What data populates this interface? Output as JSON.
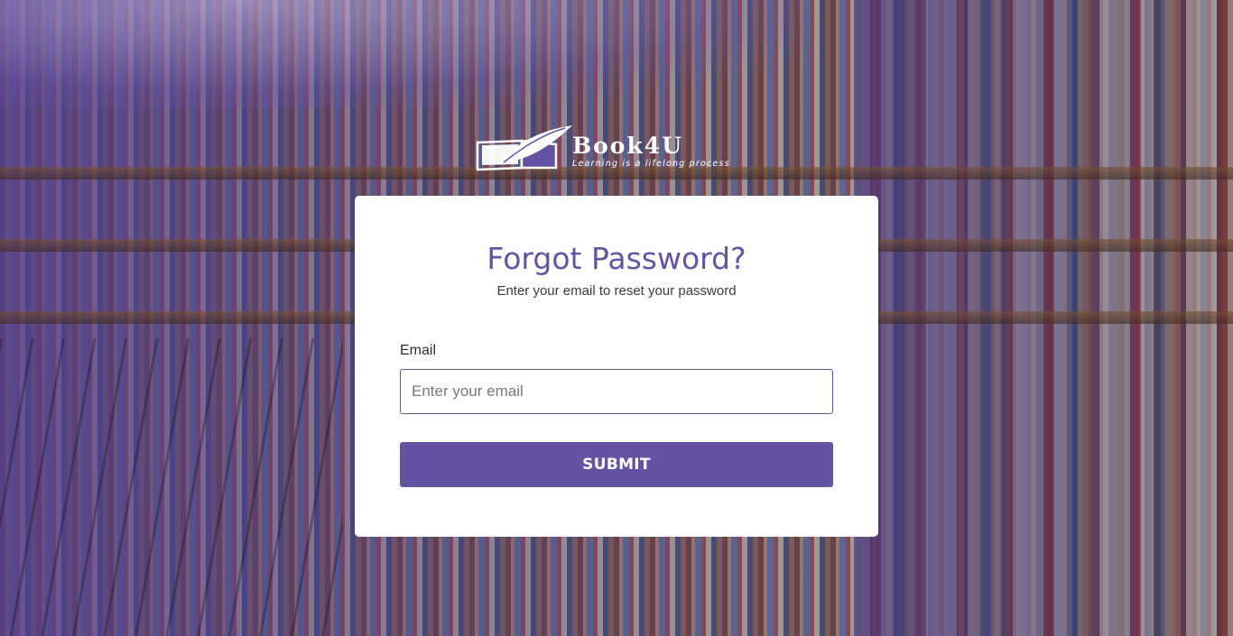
{
  "brand": {
    "name": "Book4U",
    "tagline": "Learning is a lifelong process"
  },
  "form": {
    "title": "Forgot Password?",
    "subtitle": "Enter your email to reset your password",
    "email_label": "Email",
    "email_placeholder": "Enter your email",
    "email_value": "",
    "submit_label": "SUBMIT"
  },
  "colors": {
    "accent": "#6452a3",
    "card_bg": "#ffffff",
    "overlay": "#503e8c"
  },
  "icons": {
    "logo": "open-book-with-quill-icon"
  }
}
